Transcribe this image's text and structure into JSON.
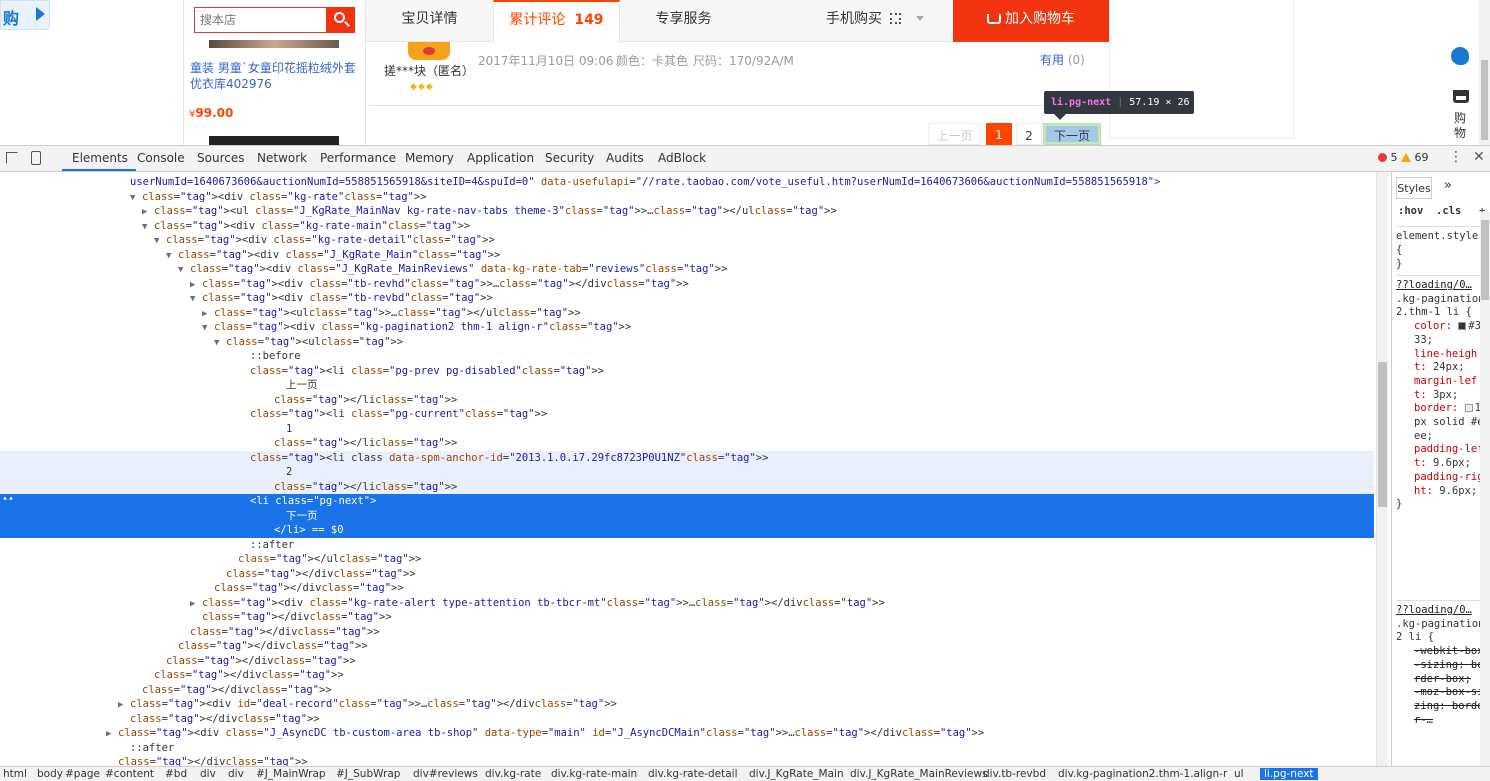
{
  "page": {
    "logo_char": "购",
    "search_placeholder": "搜本店",
    "tabs": [
      "宝贝详情",
      "累计评论",
      "专享服务",
      "手机购买"
    ],
    "review_count": "149",
    "add_cart": "加入购物车",
    "product_title": "童装 男童`女童印花摇粒绒外套 优衣库402976",
    "product_price": "99.00",
    "currency": "¥",
    "reviewer": "搓***块（匿名）",
    "review_date": "2017年11月10日 09:06",
    "review_color": "颜色：卡其色",
    "review_size": "尺码：170/92A/M",
    "useful": "有用",
    "useful_count": "(0)",
    "pager": {
      "prev": "上一页",
      "current": "1",
      "page2": "2",
      "next": "下一页"
    },
    "tooltip": {
      "selector": "li.pg-next",
      "size": "57.19 × 26"
    },
    "side_cart": "购物"
  },
  "devtools": {
    "tabs": [
      "Elements",
      "Console",
      "Sources",
      "Network",
      "Performance",
      "Memory",
      "Application",
      "Security",
      "Audits",
      "AdBlock"
    ],
    "errors": "5",
    "warnings": "69",
    "styles_tab": "Styles",
    "hov": ":hov",
    "cls": ".cls",
    "element_style": "element.style {",
    "close_brace": "}",
    "rule1_source": "??loading/0…",
    "rule1_selector": ".kg-pagination2.thm-1 li {",
    "rule2_source": "??loading/0…",
    "rule2_selector": ".kg-pagination2 li {",
    "breadcrumbs": [
      "html",
      "body",
      "#page",
      "#content",
      "#bd",
      "div",
      "div",
      "#J_MainWrap",
      "#J_SubWrap",
      "div#reviews",
      "div.kg-rate",
      "div.kg-rate-main",
      "div.kg-rate-detail",
      "div.J_KgRate_Main",
      "div.J_KgRate_MainReviews",
      "div.tb-revbd",
      "div.kg-pagination2.thm-1.align-r",
      "ul",
      "li.pg-next"
    ]
  },
  "dom_lines": [
    {
      "i": 9,
      "tri": "",
      "h": "userNumId=1640673606&auctionNumId=558851565918&siteID=4&spuId=0\" data-usefulapi=\"//rate.taobao.com/vote_useful.htm?userNumId=1640673606&auctionNumId=558851565918\">"
    },
    {
      "i": 10,
      "tri": "▼",
      "h": "<div class=\"kg-rate\">"
    },
    {
      "i": 11,
      "tri": "▶",
      "h": "<ul class=\"J_KgRate_MainNav kg-rate-nav-tabs theme-3\">…</ul>"
    },
    {
      "i": 11,
      "tri": "▼",
      "h": "<div class=\"kg-rate-main\">"
    },
    {
      "i": 12,
      "tri": "▼",
      "h": "<div class=\"kg-rate-detail\">"
    },
    {
      "i": 13,
      "tri": "▼",
      "h": "<div class=\"J_KgRate_Main\">"
    },
    {
      "i": 14,
      "tri": "▼",
      "h": "<div class=\"J_KgRate_MainReviews\" data-kg-rate-tab=\"reviews\">"
    },
    {
      "i": 15,
      "tri": "▶",
      "h": "<div class=\"tb-revhd\">…</div>"
    },
    {
      "i": 15,
      "tri": "▼",
      "h": "<div class=\"tb-revbd\">"
    },
    {
      "i": 16,
      "tri": "▶",
      "h": "<ul>…</ul>"
    },
    {
      "i": 16,
      "tri": "▼",
      "h": "<div class=\"kg-pagination2 thm-1 align-r\">"
    },
    {
      "i": 17,
      "tri": "▼",
      "h": "<ul>"
    },
    {
      "i": 19,
      "tri": "",
      "h": "::before"
    },
    {
      "i": 19,
      "tri": "",
      "h": "<li class=\"pg-prev pg-disabled\">"
    },
    {
      "i": 22,
      "tri": "",
      "h": "上一页"
    },
    {
      "i": 21,
      "tri": "",
      "h": "</li>"
    },
    {
      "i": 19,
      "tri": "",
      "h": "<li class=\"pg-current\">"
    },
    {
      "i": 22,
      "tri": "",
      "h": "1"
    },
    {
      "i": 21,
      "tri": "",
      "h": "</li>"
    },
    {
      "i": 19,
      "tri": "",
      "h": "<li class data-spm-anchor-id=\"2013.1.0.i7.29fc8723P0U1NZ\">"
    },
    {
      "i": 22,
      "tri": "",
      "h": "2"
    },
    {
      "i": 21,
      "tri": "",
      "h": "</li>"
    },
    {
      "i": 19,
      "tri": "",
      "h": "<li class=\"pg-next\">"
    },
    {
      "i": 22,
      "tri": "",
      "h": "下一页"
    },
    {
      "i": 21,
      "tri": "",
      "h": "</li> == $0"
    },
    {
      "i": 19,
      "tri": "",
      "h": "::after"
    },
    {
      "i": 18,
      "tri": "",
      "h": "</ul>"
    },
    {
      "i": 17,
      "tri": "",
      "h": "</div>"
    },
    {
      "i": 16,
      "tri": "",
      "h": "</div>"
    },
    {
      "i": 15,
      "tri": "▶",
      "h": "<div class=\"kg-rate-alert type-attention tb-tbcr-mt\">…</div>"
    },
    {
      "i": 15,
      "tri": "",
      "h": "</div>"
    },
    {
      "i": 14,
      "tri": "",
      "h": "</div>"
    },
    {
      "i": 13,
      "tri": "",
      "h": "</div>"
    },
    {
      "i": 12,
      "tri": "",
      "h": "</div>"
    },
    {
      "i": 11,
      "tri": "",
      "h": "</div>"
    },
    {
      "i": 10,
      "tri": "",
      "h": "</div>"
    },
    {
      "i": 9,
      "tri": "▶",
      "h": "<div id=\"deal-record\">…</div>"
    },
    {
      "i": 9,
      "tri": "",
      "h": "</div>"
    },
    {
      "i": 8,
      "tri": "▶",
      "h": "<div class=\"J_AsyncDC tb-custom-area tb-shop\" data-type=\"main\" id=\"J_AsyncDCMain\">…</div>"
    },
    {
      "i": 9,
      "tri": "",
      "h": "::after"
    },
    {
      "i": 8,
      "tri": "",
      "h": "</div>"
    }
  ],
  "styles": [
    {
      "k": "color:",
      "v": "#333;",
      "sw": "#333"
    },
    {
      "k": "line-height:",
      "v": "24px;"
    },
    {
      "k": "margin-left:",
      "v": "3px;"
    },
    {
      "k": "border:",
      "v": "1px solid #eee;",
      "sw": "#eee"
    },
    {
      "k": "padding-left:",
      "v": "9.6px;"
    },
    {
      "k": "padding-right:",
      "v": "9.6px;"
    }
  ],
  "struck": [
    "-webkit-box-sizing: border-box;",
    "-moz-box-sizing: border-…"
  ]
}
